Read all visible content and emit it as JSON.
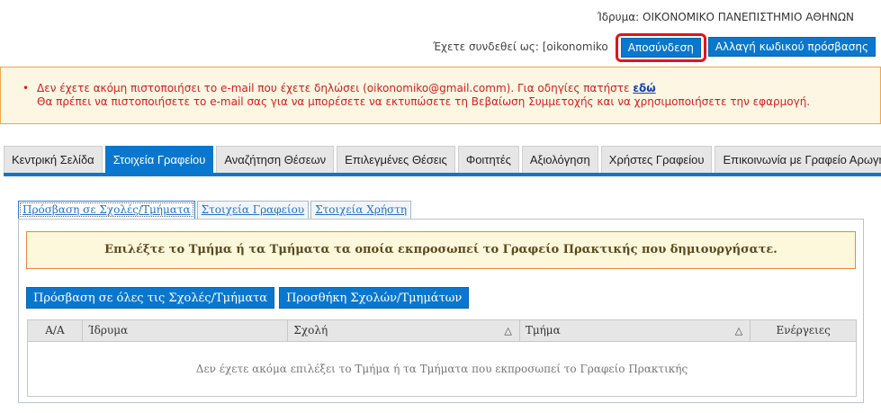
{
  "header": {
    "institution": "Ίδρυμα: ΟΙΚΟΝΟΜΙΚΟ ΠΑΝΕΠΙΣΤΗΜΙΟ ΑΘΗΝΩΝ",
    "logged_in": "Έχετε συνδεθεί ως: [oikonomiko",
    "logout_label": "Αποσύνδεση",
    "change_password_label": "Αλλαγή κωδικού πρόσβασης",
    "highlight_color": "#e0141e"
  },
  "alert": {
    "line1": "Δεν έχετε ακόμη πιστοποιήσει το e-mail που έχετε δηλώσει (oikonomiko@gmail.comm). Για οδηγίες πατήστε ",
    "link_label": "εδώ",
    "line2": "Θα πρέπει να πιστοποιήσετε το e-mail σας για να μπορέσετε να εκτυπώσετε τη Βεβαίωση Συμμετοχής και να χρησιμοποιήσετε την εφαρμογή."
  },
  "nav": {
    "tabs": [
      "Κεντρική Σελίδα",
      "Στοιχεία Γραφείου",
      "Αναζήτηση Θέσεων",
      "Επιλεγμένες Θέσεις",
      "Φοιτητές",
      "Αξιολόγηση",
      "Χρήστες Γραφείου",
      "Επικοινωνία με Γραφείο Αρωγής"
    ],
    "active_index": 1,
    "accent_color": "#0a77cf"
  },
  "subtabs": [
    "Πρόσβαση σε Σχολές/Τμήματα",
    "Στοιχεία Γραφείου",
    "Στοιχεία Χρήστη"
  ],
  "panel": {
    "notice": "Επιλέξτε το Τμήμα ή τα Τμήματα τα οποία εκπροσωπεί το Γραφείο Πρακτικής που δημιουργήσατε.",
    "access_all_label": "Πρόσβαση σε όλες τις Σχολές/Τμήματα",
    "add_label": "Προσθήκη Σχολών/Τμημάτων",
    "table": {
      "columns": [
        "Α/Α",
        "Ίδρυμα",
        "Σχολή",
        "Τμήμα",
        "Ενέργειες"
      ],
      "sort_icon": "△",
      "empty_message": "Δεν έχετε ακόμα επιλέξει το Τμήμα ή τα Τμήματα που εκπροσωπεί το Γραφείο Πρακτικής"
    }
  }
}
